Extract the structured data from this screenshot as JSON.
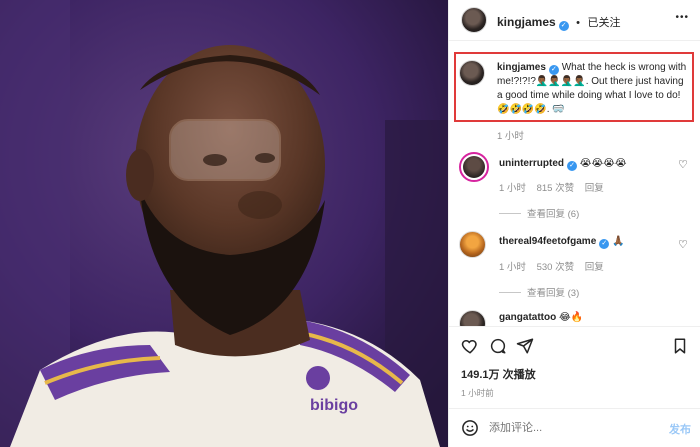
{
  "header": {
    "username": "kingjames",
    "follow_status": "已关注",
    "more": "•••"
  },
  "caption": {
    "username": "kingjames",
    "text": "What the heck is wrong with me!?!?!?🤦🏾‍♂️🤦🏾‍♂️🤦🏾‍♂️🤦🏾‍♂️. Out there just having a good time while doing what I love to do! 🤣🤣🤣🤣. 🥽",
    "time": "1 小时"
  },
  "comments": [
    {
      "username": "uninterrupted",
      "text": "😭😭😭😭",
      "time": "1 小时",
      "likes": "815 次赞",
      "reply": "回复",
      "view_replies": "查看回复 (6)"
    },
    {
      "username": "thereal94feetofgame",
      "text": "🙏🏾",
      "time": "1 小时",
      "likes": "530 次赞",
      "reply": "回复",
      "view_replies": "查看回复 (3)"
    },
    {
      "username": "gangatattoo",
      "text": "😂🔥"
    }
  ],
  "stats": {
    "views": "149.1万 次播放",
    "time": "1 小时前"
  },
  "composer": {
    "placeholder": "添加评论...",
    "post": "发布"
  },
  "media": {
    "jersey_brand": "bibigo"
  }
}
